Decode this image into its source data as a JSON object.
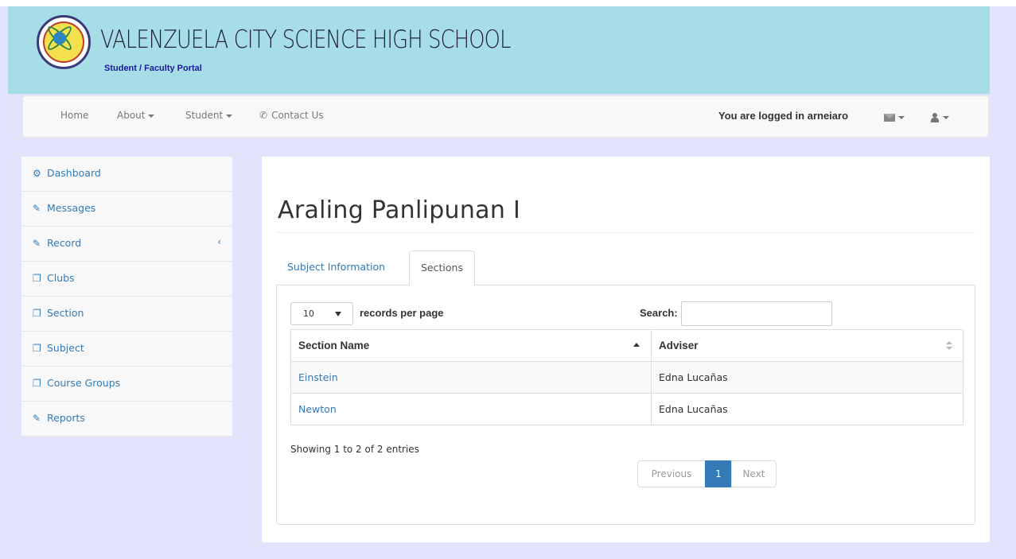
{
  "header": {
    "school_name": "VALENZUELA CITY SCIENCE HIGH SCHOOL",
    "portal_subtitle": "Student / Faculty Portal"
  },
  "navbar": {
    "home": "Home",
    "about": "About",
    "student": "Student",
    "contact": "Contact Us",
    "logged_in_text": "You are logged in arneiaro"
  },
  "sidebar": {
    "items": [
      {
        "label": "Dashboard",
        "icon": "dashboard-icon"
      },
      {
        "label": "Messages",
        "icon": "edit-icon"
      },
      {
        "label": "Record",
        "icon": "edit-icon"
      },
      {
        "label": "Clubs",
        "icon": "copy-icon"
      },
      {
        "label": "Section",
        "icon": "copy-icon"
      },
      {
        "label": "Subject",
        "icon": "copy-icon"
      },
      {
        "label": "Course Groups",
        "icon": "copy-icon"
      },
      {
        "label": "Reports",
        "icon": "edit-icon"
      }
    ]
  },
  "main": {
    "title": "Araling Panlipunan I",
    "tabs": [
      {
        "label": "Subject Information",
        "active": false
      },
      {
        "label": "Sections",
        "active": true
      }
    ],
    "table": {
      "length_value": "10",
      "length_label": "records per page",
      "search_label": "Search:",
      "search_value": "",
      "columns": [
        "Section Name",
        "Adviser"
      ],
      "rows": [
        {
          "section": "Einstein",
          "adviser": "Edna Lucañas"
        },
        {
          "section": "Newton",
          "adviser": "Edna Lucañas"
        }
      ],
      "info": "Showing 1 to 2 of 2 entries",
      "pager": {
        "previous": "Previous",
        "current": "1",
        "next": "Next"
      }
    }
  },
  "colors": {
    "banner": "#a6dde6",
    "page_background": "#e3e4fb",
    "link": "#337ab7"
  }
}
